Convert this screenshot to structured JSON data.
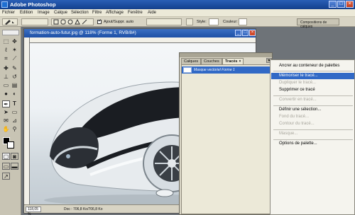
{
  "app": {
    "title": "Adobe Photoshop",
    "window_buttons": [
      "_",
      "□",
      "×"
    ]
  },
  "menubar": {
    "items": [
      "Fichier",
      "Edition",
      "Image",
      "Calque",
      "Sélection",
      "Filtre",
      "Affichage",
      "Fenêtre",
      "Aide"
    ]
  },
  "options_bar": {
    "auto_add_remove_label": "Ajout/Suppr. auto",
    "style_label": "Style:",
    "color_label": "Couleur:",
    "layer_comps_tab": "Compositions de calques"
  },
  "document": {
    "title": "formation-auto-futur.jpg @ 118% (Forme 1, RVB/8#)",
    "zoom": "118,05 %",
    "doc_info": "Doc : 706,8 Ko/706,8 Ko",
    "buttons": [
      "_",
      "□",
      "×"
    ]
  },
  "panel": {
    "tabs": [
      "Calques",
      "Couches",
      "Tracés"
    ],
    "active_tab": "Tracés",
    "close_glyph": "×",
    "path_item": "Masque vectoriel Forme 1"
  },
  "context_menu": {
    "items": [
      {
        "label": "Ancrer au conteneur de palettes",
        "disabled": false
      },
      {
        "label": "Mémoriser le tracé...",
        "disabled": false,
        "highlighted": true
      },
      {
        "label": "Dupliquer le tracé...",
        "disabled": true
      },
      {
        "label": "Supprimer ce tracé",
        "disabled": false
      },
      {
        "label": "Convertir en tracé...",
        "disabled": true
      },
      {
        "label": "Définir une sélection...",
        "disabled": false
      },
      {
        "label": "Fond du tracé...",
        "disabled": true
      },
      {
        "label": "Contour du tracé...",
        "disabled": true
      },
      {
        "label": "Masque...",
        "disabled": true
      },
      {
        "label": "Options de palette...",
        "disabled": false
      }
    ]
  },
  "colors": {
    "highlight": "#3169c6",
    "titlebar": "#1b4c9e",
    "chrome": "#ece9d8"
  }
}
